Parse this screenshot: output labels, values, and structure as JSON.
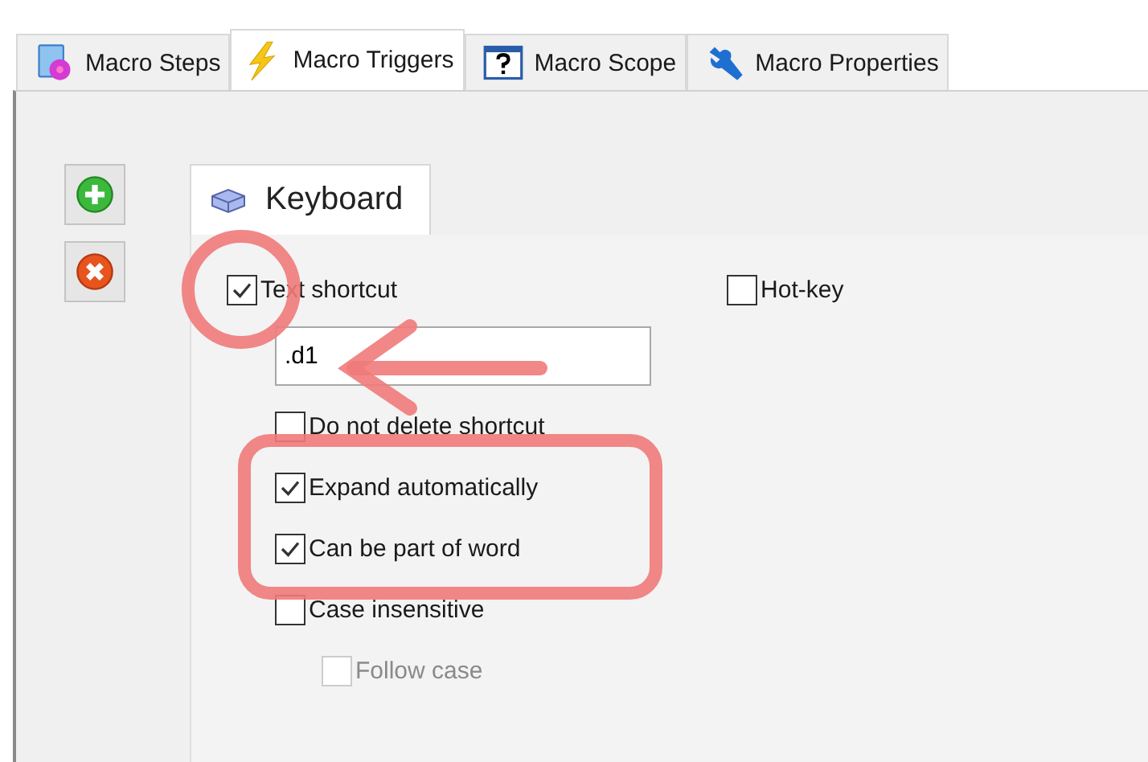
{
  "tabs": [
    {
      "label": "Macro Steps",
      "selected": false
    },
    {
      "label": "Macro Triggers",
      "selected": true
    },
    {
      "label": "Macro Scope",
      "selected": false
    },
    {
      "label": "Macro Properties",
      "selected": false
    }
  ],
  "trigger_tabs": [
    {
      "label": "Keyboard"
    }
  ],
  "text_shortcut": {
    "label": "Text shortcut",
    "checked": true,
    "value": ".d1"
  },
  "hot_key": {
    "label": "Hot-key",
    "checked": false
  },
  "options": [
    {
      "label": "Do not delete shortcut",
      "checked": false,
      "disabled": false
    },
    {
      "label": "Expand automatically",
      "checked": true,
      "disabled": false
    },
    {
      "label": "Can be part of word",
      "checked": true,
      "disabled": false
    },
    {
      "label": "Case insensitive",
      "checked": false,
      "disabled": false,
      "children": [
        {
          "label": "Follow case",
          "checked": false,
          "disabled": true
        }
      ]
    }
  ]
}
